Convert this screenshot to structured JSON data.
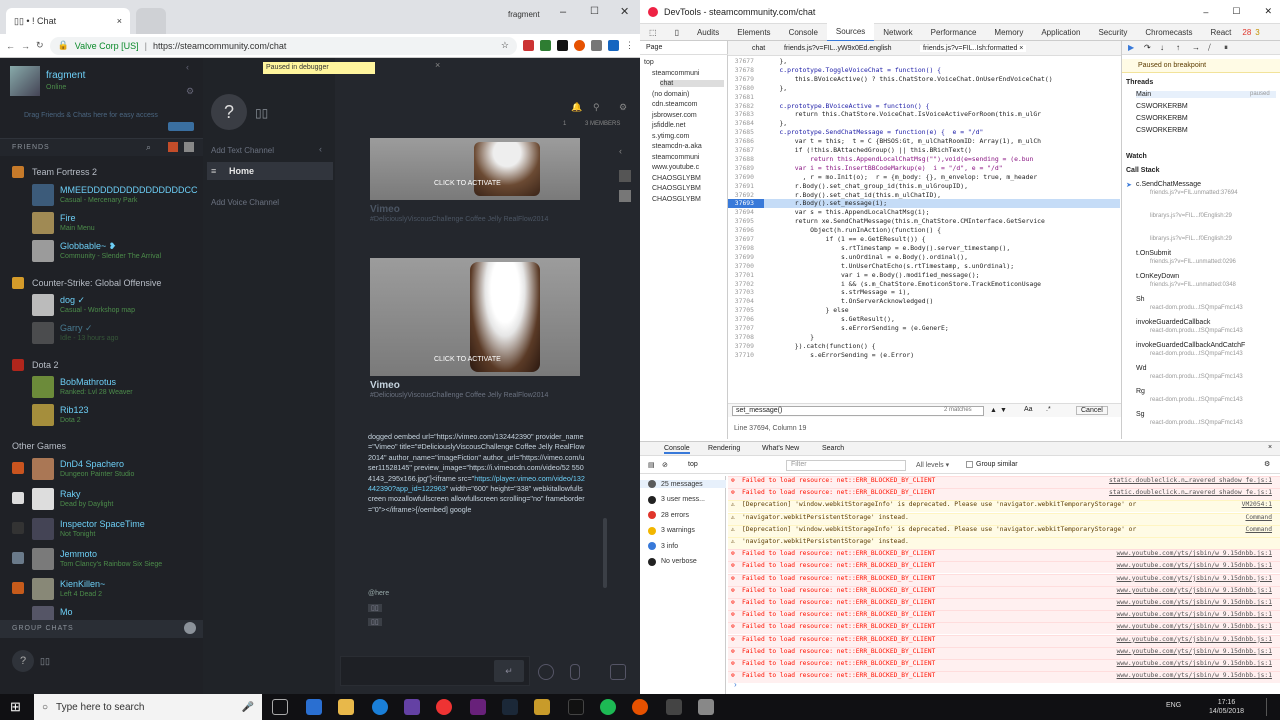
{
  "left_window": {
    "tabs": [
      {
        "label": "▯▯ • ! Chat"
      },
      {
        "label": ""
      }
    ],
    "profile_name": "fragment",
    "url_company": "Valve Corp [US]",
    "url": "https://steamcommunity.com/chat",
    "paused_banner": "Paused in debugger",
    "friends_label": "FRIENDS",
    "user_name": "fragment",
    "user_status": "Online",
    "drag_tip": "Drag Friends & Chats here for easy access",
    "friends_groups": [
      {
        "game": "Team Fortress 2",
        "friends": [
          {
            "name": "MMEEDDDDDDDDDDDDDDDCC",
            "sub": "Casual - Mercenary Park"
          },
          {
            "name": "Fire",
            "sub": "Main Menu"
          },
          {
            "name": "Globbable~ ❥",
            "sub": "Community - Slender The Arrival"
          }
        ]
      },
      {
        "game": "Counter-Strike: Global Offensive",
        "friends": [
          {
            "name": "dog ✓",
            "sub": "Casual - Workshop map"
          },
          {
            "name": "Garry ✓",
            "sub": "Idle - 13 hours ago"
          }
        ]
      },
      {
        "game": "Dota 2",
        "friends": [
          {
            "name": "BobMathrotus",
            "sub": "Ranked: Lvl 28 Weaver"
          },
          {
            "name": "Rib123",
            "sub": "Dota 2"
          }
        ]
      }
    ],
    "other_games_label": "Other Games",
    "other_friends": [
      {
        "name": "DnD4 Spachero",
        "sub": "Dungeon Painter Studio"
      },
      {
        "name": "Raky",
        "sub": "Dead by Daylight"
      },
      {
        "name": "Inspector SpaceTime",
        "sub": "Not Tonight"
      },
      {
        "name": "Jemmoto",
        "sub": "Tom Clancy's Rainbow Six Siege"
      },
      {
        "name": "KienKillen~",
        "sub": "Left 4 Dead 2"
      },
      {
        "name": "Mo",
        "sub": ""
      }
    ],
    "group_chats_label": "GROUP CHATS",
    "channel_header_title": "Add Text Channel",
    "channel_home": "Home",
    "add_voice_channel": "Add Voice Channel",
    "chat_header_count": "▯▯",
    "chat_header_badge1": "1",
    "chat_header_badge2": "3 MEMBERS",
    "vimeo_click_1": "CLICK TO ACTIVATE",
    "vimeo_title": "Vimeo",
    "vimeo_tag": "#DeliciouslyViscousChallenge Coffee Jelly RealFlow2014",
    "vimeo_click_2": "CLICK TO ACTIVATE",
    "message_text": "dogged oembed url=\"https://vimeo.com/132442390\" provider_name=\"Vimeo\" title=\"#DeliciouslyViscousChallenge Coffee Jelly RealFlow2014\" author_name=\"imageFiction\" author_url=\"https://vimeo.com/user11528145\" preview_image=\"https://i.vimeocdn.com/video/52 5504143_295x166.jpg\"]<iframe src=\"",
    "message_link": "https://player.vimeo.com/video/132442390?app_id=122963",
    "message_text2": "\" width=\"600\" height=\"338\" webkitallowfullscreen mozallowfullscreen allowfullscreen scrolling=\"no\" frameborder=\"0\"></iframe>[/oembed] google",
    "message_here": "@here",
    "message_pill1": "▯▯",
    "message_pill2": "▯▯"
  },
  "devtools": {
    "title": "DevTools - steamcommunity.com/chat",
    "tabs": [
      "Audits",
      "Elements",
      "Console",
      "Sources",
      "Network",
      "Performance",
      "Memory",
      "Application",
      "Security",
      "Chromecasts",
      "React"
    ],
    "active_tab": "Sources",
    "errors_badge": "28",
    "warnings_badge": "3",
    "page_tab": "Page",
    "file_tabs": [
      "chat",
      "friends.js?v=FIL..yW9x0Ed.english",
      "friends.js?v=FIL..Ish:formatted ×"
    ],
    "nav_tree": [
      "top",
      "steamcommuni",
      "chat",
      "(no domain)",
      "cdn.steamcom",
      "jsbrowser.com",
      "jsfiddle.net",
      "s.ytimg.com",
      "steamcdn-a.aka",
      "steamcommuni",
      "www.youtube.c",
      "CHAOSGLYBM",
      "CHAOSGLYBM",
      "CHAOSGLYBM"
    ],
    "code": [
      {
        "n": "37677",
        "t": "    },"
      },
      {
        "n": "37678",
        "t": "    c.prototype.ToggleVoiceChat = function() {"
      },
      {
        "n": "37679",
        "t": "        this.BVoiceActive() ? this.ChatStore.VoiceChat.OnUserEndVoiceChat()"
      },
      {
        "n": "37680",
        "t": "    },"
      },
      {
        "n": "37681",
        "t": ""
      },
      {
        "n": "37682",
        "t": "    c.prototype.BVoiceActive = function() {"
      },
      {
        "n": "37683",
        "t": "        return this.ChatStore.VoiceChat.IsVoiceActiveForRoom(this.m_ulGr"
      },
      {
        "n": "37684",
        "t": "    },"
      },
      {
        "n": "37685",
        "t": "    c.prototype.SendChatMessage = function(e) {  e = \"/d\""
      },
      {
        "n": "37686",
        "t": "        var t = this;  t = C {BHSOS:Gt, m_ulChatRoomID: Array(1), m_ulCh"
      },
      {
        "n": "37687",
        "t": "        if (!this.BAttachedGroup() || this.BRichText()"
      },
      {
        "n": "37688",
        "t": "            return this.AppendLocalChatMsg(\"\"),void(e=sending = (e.bun"
      },
      {
        "n": "37689",
        "t": "        var i = this.InsertBBCodeMarkup(e)  i = \"/d\", e = \"/d\""
      },
      {
        "n": "37690",
        "t": "          , r = mo.Init(o);  r = {m_body: {}, m_envelop: true, m_header"
      },
      {
        "n": "37691",
        "t": "        r.Body().set_chat_group_id(this.m_ulGroupID),"
      },
      {
        "n": "37692",
        "t": "        r.Body().set_chat_id(this.m_ulChatID),"
      },
      {
        "n": "37693",
        "t": "        r.Body().set_message(i);"
      },
      {
        "n": "37694",
        "t": "        var s = this.AppendLocalChatMsg(i);"
      },
      {
        "n": "37695",
        "t": "        return xe.SendChatMessage(this.m_ChatStore.CMInterface.GetService"
      },
      {
        "n": "37696",
        "t": "            Object(h.runInAction)(function() {"
      },
      {
        "n": "37697",
        "t": "                if (1 == e.GetEResult()) {"
      },
      {
        "n": "37698",
        "t": "                    s.rtTimestamp = e.Body().server_timestamp(),"
      },
      {
        "n": "37699",
        "t": "                    s.unOrdinal = e.Body().ordinal(),"
      },
      {
        "n": "37700",
        "t": "                    t.UnUserChatEcho(s.rtTimestamp, s.unOrdinal);"
      },
      {
        "n": "37701",
        "t": "                    var i = e.Body().modified_message();"
      },
      {
        "n": "37702",
        "t": "                    i && (s.m_ChatStore.EmoticonStore.TrackEmoticonUsage"
      },
      {
        "n": "37703",
        "t": "                    s.strMessage = i),"
      },
      {
        "n": "37704",
        "t": "                    t.OnServerAcknowledged()"
      },
      {
        "n": "37705",
        "t": "                } else"
      },
      {
        "n": "37706",
        "t": "                    s.GetResult(),"
      },
      {
        "n": "37707",
        "t": "                    s.eErrorSending = (e.GenerE;"
      },
      {
        "n": "37708",
        "t": "            }"
      },
      {
        "n": "37709",
        "t": "        }).catch(function() {"
      },
      {
        "n": "37710",
        "t": "            s.eErrorSending = (e.Error)"
      }
    ],
    "highlight_line": "37693",
    "search_value": "set_message()",
    "search_matches": "2 matches",
    "search_aa": "Aa",
    "search_dotstar": ".*",
    "search_cancel": "Cancel",
    "status_line": "Line 37694, Column 19",
    "paused_label": "Paused on breakpoint",
    "threads_label": "Threads",
    "threads": [
      {
        "name": "Main",
        "state": "paused"
      },
      {
        "name": "CSWORKERBM",
        "state": ""
      },
      {
        "name": "CSWORKERBM",
        "state": ""
      },
      {
        "name": "CSWORKERBM",
        "state": ""
      }
    ],
    "watch_label": "Watch",
    "callstack_label": "Call Stack",
    "callstack": [
      {
        "fn": "c.SendChatMessage",
        "file": "friends.js?v=FIL.unmatted:37694"
      },
      {
        "fn": "",
        "file": "librarys.js?v=FIL...f0English:29"
      },
      {
        "fn": "",
        "file": "librarys.js?v=FIL...f0English:29"
      },
      {
        "fn": "t.OnSubmit",
        "file": "friends.js?v=FIL..unmatted:0296"
      },
      {
        "fn": "t.OnKeyDown",
        "file": "friends.js?v=FIL..unmatted:0348"
      },
      {
        "fn": "Sh",
        "file": "react-dom.produ...tSQmpaFmc143"
      },
      {
        "fn": "invokeGuardedCallback",
        "file": "react-dom.produ...tSQmpaFmc143"
      },
      {
        "fn": "invokeGuardedCallbackAndCatchF",
        "file": "react-dom.produ...tSQmpaFmc143"
      },
      {
        "fn": "Wd",
        "file": "react-dom.produ...tSQmpaFmc143"
      },
      {
        "fn": "Rg",
        "file": "react-dom.produ...tSQmpaFmc143"
      },
      {
        "fn": "Sg",
        "file": "react-dom.produ...tSQmpaFmc143"
      }
    ],
    "drawer_tabs": [
      "Console",
      "Rendering",
      "What's New",
      "Search"
    ],
    "filter_top": "top",
    "filter_placeholder": "Filter",
    "levels_label": "All levels ▾",
    "group_similar": "Group similar",
    "console_side": [
      {
        "label": "25 messages",
        "color": "#5a5a5a"
      },
      {
        "label": "3 user mess...",
        "color": "#222"
      },
      {
        "label": "28 errors",
        "color": "#e0352b"
      },
      {
        "label": "3 warnings",
        "color": "#f2b600"
      },
      {
        "label": "3 info",
        "color": "#3879d9"
      },
      {
        "label": "No verbose",
        "color": "#222"
      }
    ],
    "console_msgs": [
      {
        "kind": "err",
        "text": "Failed to load resource: net::ERR_BLOCKED_BY_CLIENT",
        "src": "static.doubleclick.n…ravered_shadow_fe.js:1"
      },
      {
        "kind": "err",
        "text": "Failed to load resource: net::ERR_BLOCKED_BY_CLIENT",
        "src": "static.doubleclick.n…ravered_shadow_fe.js:1"
      },
      {
        "kind": "warn",
        "text": "[Deprecation] 'window.webkitStorageInfo' is deprecated. Please use 'navigator.webkitTemporaryStorage' or",
        "src": "VM2054:1"
      },
      {
        "kind": "warn",
        "text": "'navigator.webkitPersistentStorage' instead.",
        "src": "Command"
      },
      {
        "kind": "warn",
        "text": "[Deprecation] 'window.webkitStorageInfo' is deprecated. Please use 'navigator.webkitTemporaryStorage' or",
        "src": "Command"
      },
      {
        "kind": "warn",
        "text": "'navigator.webkitPersistentStorage' instead.",
        "src": ""
      },
      {
        "kind": "err",
        "text": "Failed to load resource: net::ERR_BLOCKED_BY_CLIENT",
        "src": "www.youtube.com/yts/jsbin/w_9.15dnbb.js:1"
      },
      {
        "kind": "err",
        "text": "Failed to load resource: net::ERR_BLOCKED_BY_CLIENT",
        "src": "www.youtube.com/yts/jsbin/w_9.15dnbb.js:1"
      },
      {
        "kind": "err",
        "text": "Failed to load resource: net::ERR_BLOCKED_BY_CLIENT",
        "src": "www.youtube.com/yts/jsbin/w_9.15dnbb.js:1"
      },
      {
        "kind": "err",
        "text": "Failed to load resource: net::ERR_BLOCKED_BY_CLIENT",
        "src": "www.youtube.com/yts/jsbin/w_9.15dnbb.js:1"
      },
      {
        "kind": "err",
        "text": "Failed to load resource: net::ERR_BLOCKED_BY_CLIENT",
        "src": "www.youtube.com/yts/jsbin/w_9.15dnbb.js:1"
      },
      {
        "kind": "err",
        "text": "Failed to load resource: net::ERR_BLOCKED_BY_CLIENT",
        "src": "www.youtube.com/yts/jsbin/w_9.15dnbb.js:1"
      },
      {
        "kind": "err",
        "text": "Failed to load resource: net::ERR_BLOCKED_BY_CLIENT",
        "src": "www.youtube.com/yts/jsbin/w_9.15dnbb.js:1"
      },
      {
        "kind": "err",
        "text": "Failed to load resource: net::ERR_BLOCKED_BY_CLIENT",
        "src": "www.youtube.com/yts/jsbin/w_9.15dnbb.js:1"
      },
      {
        "kind": "err",
        "text": "Failed to load resource: net::ERR_BLOCKED_BY_CLIENT",
        "src": "www.youtube.com/yts/jsbin/w_9.15dnbb.js:1"
      },
      {
        "kind": "err",
        "text": "Failed to load resource: net::ERR_BLOCKED_BY_CLIENT",
        "src": "www.youtube.com/yts/jsbin/w_9.15dnbb.js:1"
      },
      {
        "kind": "err",
        "text": "Failed to load resource: net::ERR_BLOCKED_BY_CLIENT",
        "src": "www.youtube.com/yts/jsbin/w_9.15dnbb.js:1"
      }
    ]
  },
  "taskbar": {
    "search_placeholder": "Type here to search",
    "time": "17:16",
    "date": "14/05/2018",
    "lang": "ENG"
  }
}
